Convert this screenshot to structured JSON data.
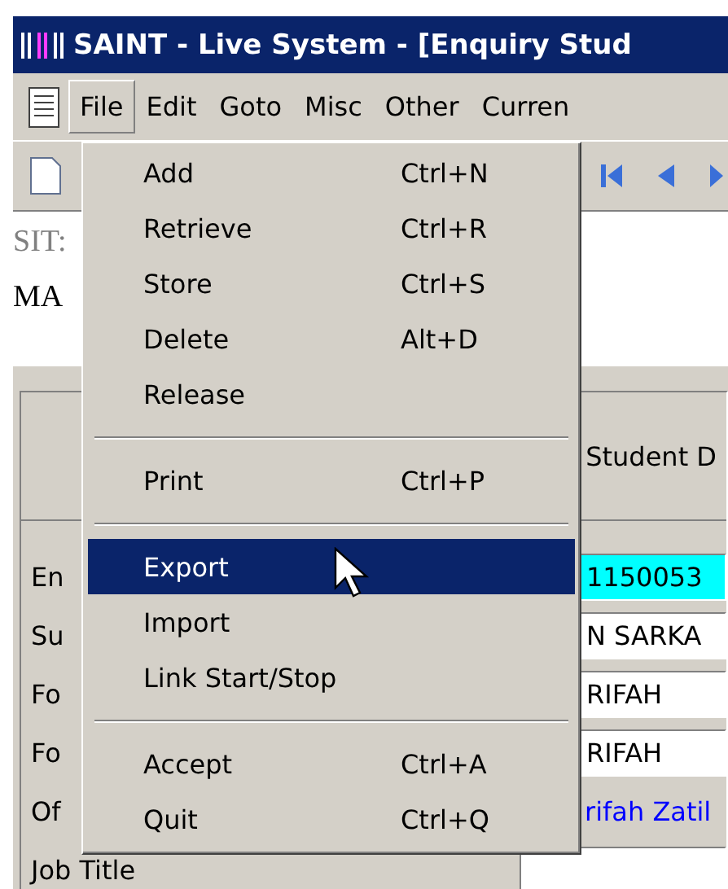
{
  "window": {
    "title": "SAINT - Live System - [Enquiry Stud"
  },
  "menu_bar": [
    {
      "label": "File",
      "selected": true
    },
    {
      "label": "Edit",
      "selected": false
    },
    {
      "label": "Goto",
      "selected": false
    },
    {
      "label": "Misc",
      "selected": false
    },
    {
      "label": "Other",
      "selected": false
    },
    {
      "label": "Curren",
      "selected": false
    }
  ],
  "header": {
    "line_1": "SIT:",
    "line_2": "MA"
  },
  "panel": {
    "heading": "Student D",
    "rows": [
      {
        "label": "En",
        "kind": "key",
        "value": "1150053"
      },
      {
        "label": "Su",
        "kind": "field",
        "value": "N SARKA"
      },
      {
        "label": "Fo",
        "kind": "field",
        "value": "RIFAH"
      },
      {
        "label": "Fo",
        "kind": "field",
        "value": "RIFAH"
      },
      {
        "label": "Of",
        "kind": "link",
        "value": "rifah Zatil"
      },
      {
        "label": "Job Title",
        "kind": "field"
      }
    ]
  },
  "file_menu": {
    "items": [
      {
        "kind": "item",
        "label": "Add",
        "shortcut": "Ctrl+N",
        "selected": false
      },
      {
        "kind": "item",
        "label": "Retrieve",
        "shortcut": "Ctrl+R",
        "selected": false
      },
      {
        "kind": "item",
        "label": "Store",
        "shortcut": "Ctrl+S",
        "selected": false
      },
      {
        "kind": "item",
        "label": "Delete",
        "shortcut": "Alt+D",
        "selected": false
      },
      {
        "kind": "item",
        "label": "Release",
        "selected": false
      },
      {
        "kind": "separator"
      },
      {
        "kind": "item",
        "label": "Print",
        "shortcut": "Ctrl+P",
        "selected": false
      },
      {
        "kind": "separator"
      },
      {
        "kind": "item",
        "label": "Export",
        "selected": true
      },
      {
        "kind": "item",
        "label": "Import",
        "selected": false
      },
      {
        "kind": "item",
        "label": "Link Start/Stop",
        "selected": false
      },
      {
        "kind": "separator"
      },
      {
        "kind": "item",
        "label": "Accept",
        "shortcut": "Ctrl+A",
        "selected": false
      },
      {
        "kind": "item",
        "label": "Quit",
        "shortcut": "Ctrl+Q",
        "selected": false
      }
    ]
  }
}
